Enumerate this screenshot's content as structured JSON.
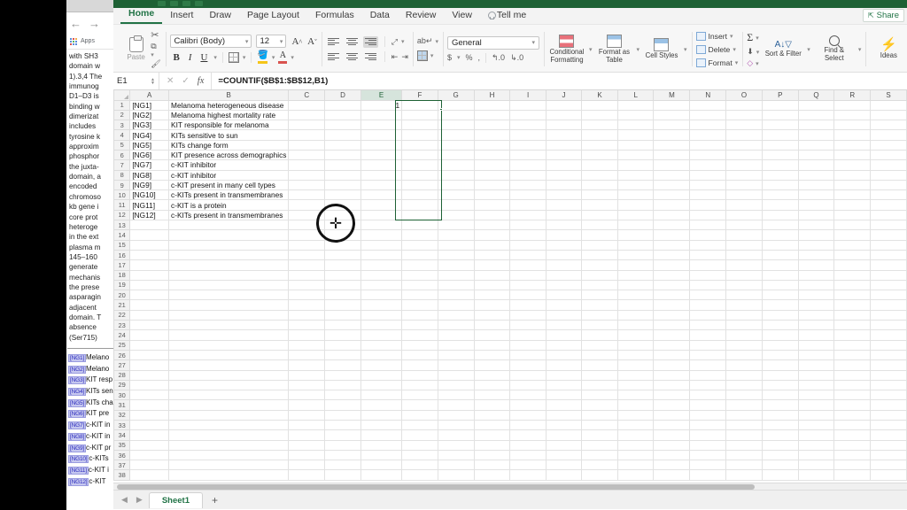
{
  "browser": {
    "back_icon": "←",
    "forward_icon": "→",
    "apps_label": "Apps",
    "doc_lines": [
      "with SH3",
      "domain w",
      "1).3,4 The",
      "immunog",
      "D1–D3 is",
      "binding w",
      "dimerizat",
      "includes",
      "tyrosine k",
      "approxim",
      "phosphor",
      "the juxta-",
      "domain, a",
      "encoded",
      "chromoso",
      "kb gene i",
      "core prot",
      "heteroge",
      "in the ext",
      "plasma m",
      "145–160",
      "generate",
      "mechanis",
      "the prese",
      "asparagin",
      "adjacent",
      "domain. T",
      "absence",
      "(Ser715)"
    ],
    "ng_links": [
      {
        "tag": "[NG1]",
        "text": "Melano"
      },
      {
        "tag": "[NG2]",
        "text": "Melano"
      },
      {
        "tag": "[NG3]",
        "text": "KIT resp"
      },
      {
        "tag": "[NG4]",
        "text": "KITs sen"
      },
      {
        "tag": "[NG5]",
        "text": "KITs cha"
      },
      {
        "tag": "[NG6]",
        "text": "KIT pre"
      },
      {
        "tag": "[NG7]",
        "text": "c-KIT in"
      },
      {
        "tag": "[NG8]",
        "text": "c-KIT in"
      },
      {
        "tag": "[NG9]",
        "text": "c-KIT pr"
      },
      {
        "tag": "[NG10]",
        "text": "c-KITs"
      },
      {
        "tag": "[NG11]",
        "text": "c-KIT i"
      },
      {
        "tag": "[NG12]",
        "text": "c-KIT"
      }
    ]
  },
  "ribbon": {
    "tabs": [
      {
        "label": "Home",
        "active": true
      },
      {
        "label": "Insert",
        "active": false
      },
      {
        "label": "Draw",
        "active": false
      },
      {
        "label": "Page Layout",
        "active": false
      },
      {
        "label": "Formulas",
        "active": false
      },
      {
        "label": "Data",
        "active": false
      },
      {
        "label": "Review",
        "active": false
      },
      {
        "label": "View",
        "active": false
      }
    ],
    "tell_me": "Tell me",
    "share": "Share",
    "clipboard": {
      "paste_label": "Paste"
    },
    "font": {
      "name": "Calibri (Body)",
      "size": "12",
      "grow_label": "A",
      "shrink_label": "A",
      "bold": "B",
      "italic": "I",
      "underline": "U"
    },
    "number": {
      "format": "General",
      "currency": "$",
      "percent": "%",
      "comma": ","
    },
    "styles": {
      "conditional_formatting": "Conditional Formatting",
      "format_as_table": "Format as Table",
      "cell_styles": "Cell Styles"
    },
    "cells": {
      "insert": "Insert",
      "delete": "Delete",
      "format": "Format"
    },
    "editing": {
      "autosum": "Σ",
      "sort_filter": "Sort & Filter",
      "find_select": "Find & Select"
    },
    "ideas": "Ideas"
  },
  "formula_bar": {
    "name_box": "E1",
    "cancel_icon": "✕",
    "enter_icon": "✓",
    "fx_icon": "fx",
    "formula": "=COUNTIF($B$1:$B$12,B1)"
  },
  "sheet": {
    "columns": [
      "A",
      "B",
      "C",
      "D",
      "E",
      "F",
      "G",
      "H",
      "I",
      "J",
      "K",
      "L",
      "M",
      "N",
      "O",
      "P",
      "Q",
      "R",
      "S"
    ],
    "selected_column": "E",
    "row_count": 38,
    "selected_row": 1,
    "rows": [
      {
        "n": 1,
        "A": "[NG1]",
        "B": "Melanoma heterogeneous disease",
        "E": "1"
      },
      {
        "n": 2,
        "A": "[NG2]",
        "B": "Melanoma highest mortality rate",
        "E": ""
      },
      {
        "n": 3,
        "A": "[NG3]",
        "B": "KIT responsible for melanoma",
        "E": ""
      },
      {
        "n": 4,
        "A": "[NG4]",
        "B": "KITs sensitive to sun",
        "E": ""
      },
      {
        "n": 5,
        "A": "[NG5]",
        "B": "KITs change form",
        "E": ""
      },
      {
        "n": 6,
        "A": "[NG6]",
        "B": "KIT presence across demographics",
        "E": ""
      },
      {
        "n": 7,
        "A": "[NG7]",
        "B": "c-KIT inhibitor",
        "E": ""
      },
      {
        "n": 8,
        "A": "[NG8]",
        "B": "c-KIT inhibitor",
        "E": ""
      },
      {
        "n": 9,
        "A": "[NG9]",
        "B": "c-KIT present in many cell types",
        "E": ""
      },
      {
        "n": 10,
        "A": "[NG10]",
        "B": "c-KITs present in transmembranes",
        "E": ""
      },
      {
        "n": 11,
        "A": "[NG11]",
        "B": "c-KIT is a protein",
        "E": ""
      },
      {
        "n": 12,
        "A": "[NG12]",
        "B": "c-KITs present in transmembranes",
        "E": ""
      }
    ],
    "selection_range": "E1:E12"
  },
  "status": {
    "prev_sheet_icon": "◀",
    "next_sheet_icon": "▶",
    "sheet_name": "Sheet1",
    "add_sheet_icon": "+"
  },
  "colors": {
    "excel_green": "#217346",
    "titlebar_green": "#1e6135",
    "link_blue": "#1a0dab",
    "tag_violet": "#2b2bbd"
  }
}
